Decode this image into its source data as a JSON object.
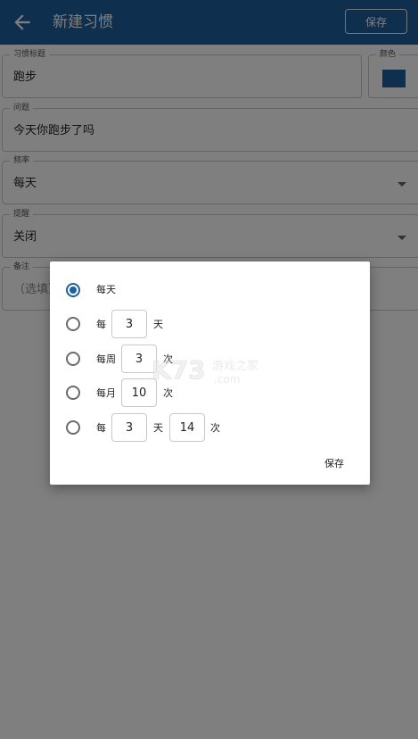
{
  "appbar": {
    "title": "新建习惯",
    "save_label": "保存"
  },
  "form": {
    "title_label": "习惯标题",
    "title_value": "跑步",
    "color_label": "颜色",
    "color_value": "#1f5f9f",
    "question_label": "问题",
    "question_value": "今天你跑步了吗",
    "frequency_label": "频率",
    "frequency_value": "每天",
    "reminder_label": "提醒",
    "reminder_value": "关闭",
    "notes_label": "备注",
    "notes_placeholder": "（选填）"
  },
  "dialog": {
    "options": [
      {
        "label": "每天",
        "selected": true
      },
      {
        "prefix": "每",
        "value": "3",
        "suffix": "天",
        "selected": false
      },
      {
        "prefix": "每周",
        "value": "3",
        "suffix": "次",
        "selected": false
      },
      {
        "prefix": "每月",
        "value": "10",
        "suffix": "次",
        "selected": false
      },
      {
        "prefix": "每",
        "value": "3",
        "middle": "天",
        "value2": "14",
        "suffix": "次",
        "selected": false
      }
    ],
    "save_label": "保存"
  },
  "watermark": {
    "text": "K73",
    "sub": "游戏之家",
    "domain": ".com"
  }
}
